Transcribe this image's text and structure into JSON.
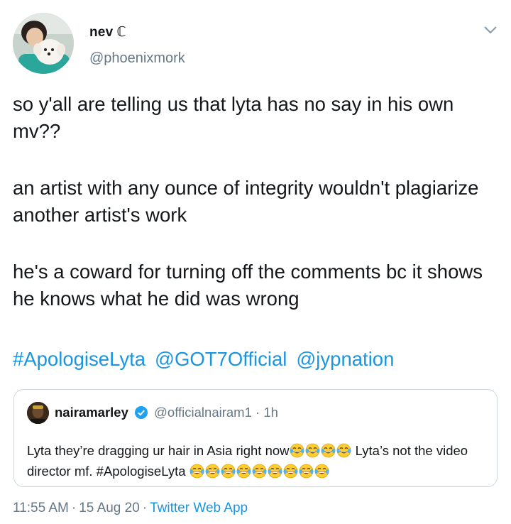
{
  "author": {
    "display_name": "nev",
    "name_symbol": "ℂ",
    "handle": "@phoenixmork"
  },
  "tweet": {
    "paragraphs": [
      "so y'all are telling us that lyta has no say in his own mv??",
      "an artist with any ounce of integrity wouldn't plagiarize another artist's work",
      "he's a coward for turning off the comments bc it shows he knows what he did was wrong"
    ],
    "tags": [
      "#ApologiseLyta",
      "@GOT7Official",
      "@jypnation"
    ]
  },
  "quoted": {
    "display_name": "nairamarley",
    "handle": "@officialnairam1",
    "separator": "·",
    "time": "1h",
    "text_part1": "Lyta they’re dragging ur hair in Asia right now",
    "text_part2": " Lyta’s not the video director mf. ",
    "hashtag": "#ApologiseLyta",
    "emoji_name": "face-with-tears-of-joy-icon",
    "emoji_count_1": 4,
    "emoji_count_2": 9
  },
  "meta": {
    "time": "11:55 AM",
    "date": "15 Aug 20",
    "separator": "·",
    "source": "Twitter Web App"
  },
  "colors": {
    "link": "#1b95e0",
    "text": "#14171a",
    "secondary": "#657786",
    "border": "#ccd6dd",
    "verified": "#1da1f2"
  },
  "icons": {
    "menu": "chevron-down-icon",
    "verified": "verified-badge-icon"
  }
}
